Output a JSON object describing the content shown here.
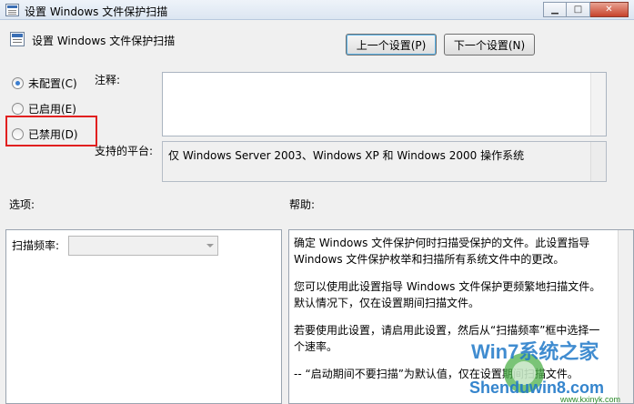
{
  "window": {
    "title": "设置 Windows 文件保护扫描",
    "minimize_glyph": "▁",
    "maximize_glyph": "□",
    "close_glyph": "✕"
  },
  "header": {
    "title": "设置 Windows 文件保护扫描",
    "prev_button": "上一个设置(P)",
    "next_button": "下一个设置(N)"
  },
  "state": {
    "options": [
      {
        "label": "未配置(C)",
        "checked": true
      },
      {
        "label": "已启用(E)",
        "checked": false
      },
      {
        "label": "已禁用(D)",
        "checked": false
      }
    ]
  },
  "comment": {
    "label": "注释:",
    "value": ""
  },
  "platform": {
    "label": "支持的平台:",
    "value": "仅 Windows Server 2003、Windows XP 和 Windows 2000 操作系统"
  },
  "options_section": {
    "label": "选项:",
    "scan_frequency_label": "扫描频率:",
    "scan_frequency_value": ""
  },
  "help_section": {
    "label": "帮助:",
    "paragraphs": [
      "确定 Windows 文件保护何时扫描受保护的文件。此设置指导 Windows 文件保护枚举和扫描所有系统文件中的更改。",
      "您可以使用此设置指导 Windows 文件保护更频繁地扫描文件。默认情况下，仅在设置期间扫描文件。",
      "若要使用此设置，请启用此设置，然后从“扫描频率”框中选择一个速率。",
      "-- “启动期间不要扫描”为默认值，仅在设置期间扫描文件。"
    ]
  },
  "watermark": {
    "text1": "Win7系统之家",
    "text2": "Shenduwin8.com",
    "text3": "www.kxinyk.com"
  }
}
